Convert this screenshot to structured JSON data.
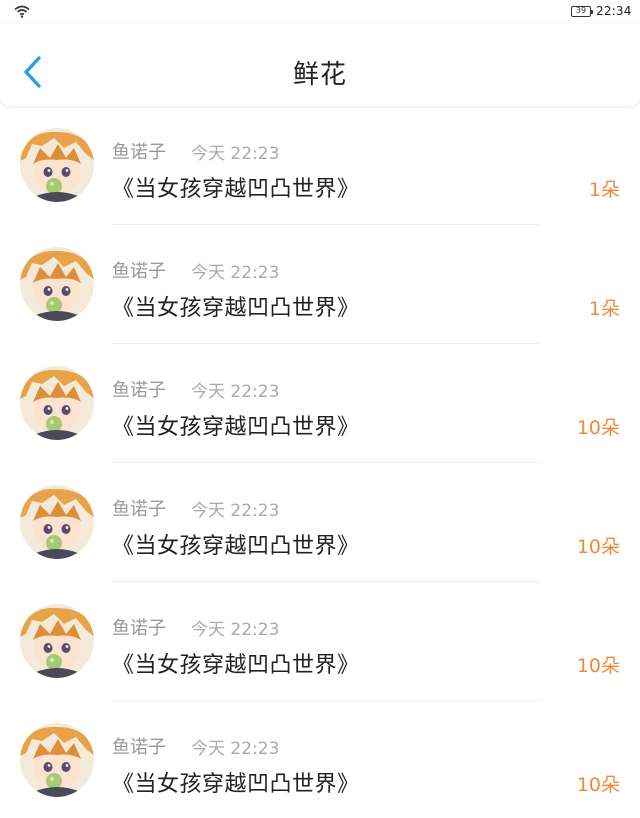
{
  "status": {
    "battery": "39",
    "time": "22:34"
  },
  "nav": {
    "title": "鲜花"
  },
  "entries": [
    {
      "sender": "鱼诺子",
      "time": "今天 22:23",
      "book": "《当女孩穿越凹凸世界》",
      "count": "1朵"
    },
    {
      "sender": "鱼诺子",
      "time": "今天 22:23",
      "book": "《当女孩穿越凹凸世界》",
      "count": "1朵"
    },
    {
      "sender": "鱼诺子",
      "time": "今天 22:23",
      "book": "《当女孩穿越凹凸世界》",
      "count": "10朵"
    },
    {
      "sender": "鱼诺子",
      "time": "今天 22:23",
      "book": "《当女孩穿越凹凸世界》",
      "count": "10朵"
    },
    {
      "sender": "鱼诺子",
      "time": "今天 22:23",
      "book": "《当女孩穿越凹凸世界》",
      "count": "10朵"
    },
    {
      "sender": "鱼诺子",
      "time": "今天 22:23",
      "book": "《当女孩穿越凹凸世界》",
      "count": "10朵"
    }
  ],
  "colors": {
    "accent": "#f08a3a",
    "back": "#2a9de6"
  }
}
